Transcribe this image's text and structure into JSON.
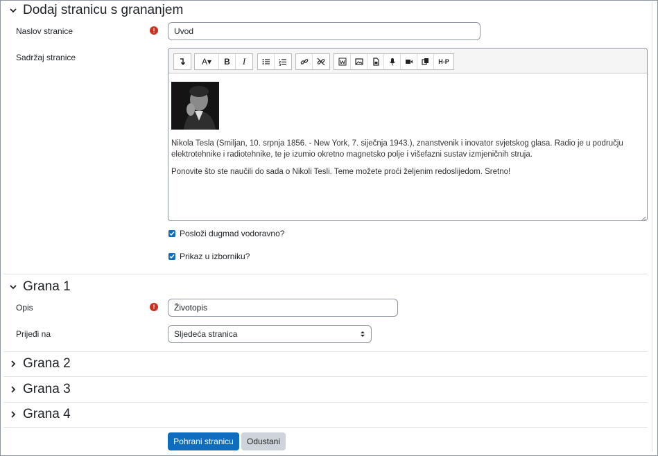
{
  "section_main": {
    "title": "Dodaj stranicu s grananjem",
    "title_label": "Naslov stranice",
    "title_value": "Uvod",
    "content_label": "Sadržaj stranice",
    "editor_paragraphs": [
      "Nikola Tesla (Smiljan, 10. srpnja 1856. - New York, 7. siječnja 1943.), znanstvenik i inovator svjetskog glasa. Radio je u području elektrotehnike i radiotehnike, te je izumio okretno magnetsko polje i višefazni sustav izmjeničnih struja.",
      "Ponovite što ste naučili do sada o Nikoli Tesli. Teme možete proći željenim redoslijedom. Sretno!"
    ],
    "toolbar": {
      "font_label": "A▾",
      "bold": "B",
      "italic": "I",
      "h5p": "H-P"
    },
    "checkbox_horizontal": "Posloži dugmad vodoravno?",
    "checkbox_menu": "Prikaz u izborniku?"
  },
  "branch1": {
    "title": "Grana 1",
    "desc_label": "Opis",
    "desc_value": "Životopis",
    "jump_label": "Prijeđi na",
    "jump_value": "Sljedeća stranica"
  },
  "branch2": {
    "title": "Grana 2"
  },
  "branch3": {
    "title": "Grana 3"
  },
  "branch4": {
    "title": "Grana 4"
  },
  "buttons": {
    "save": "Pohrani stranicu",
    "cancel": "Odustani"
  },
  "colors": {
    "primary": "#0f6cbf",
    "required": "#ca3120",
    "secondary": "#ced4da"
  }
}
